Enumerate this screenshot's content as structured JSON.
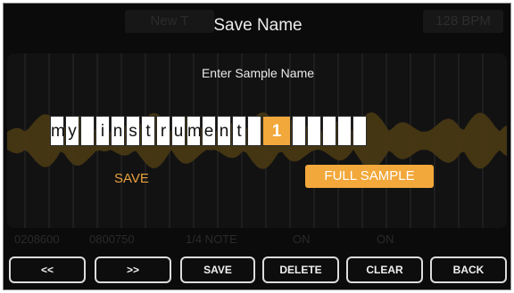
{
  "background_status": {
    "left_label": "New T",
    "tempo": "128 BPM"
  },
  "dialog": {
    "title": "Save Name",
    "prompt": "Enter Sample Name"
  },
  "name_field": {
    "characters": [
      "m",
      "y",
      " ",
      "i",
      "n",
      "s",
      "t",
      "r",
      "u",
      "m",
      "e",
      "n",
      "t",
      " ",
      "1",
      " ",
      " ",
      " ",
      " ",
      " "
    ],
    "cursor_index": 14
  },
  "options": {
    "save_label": "SAVE",
    "mode_label": "FULL SAMPLE"
  },
  "background_params": {
    "start": "0208600",
    "end": "0800750",
    "division": "1/4 NOTE",
    "param_a": "ON",
    "param_b": "ON"
  },
  "soft_buttons": [
    "<<",
    ">>",
    "SAVE",
    "DELETE",
    "CLEAR",
    "BACK"
  ],
  "colors": {
    "accent": "#f2a83a",
    "screen_bg": "#0b0b0b",
    "panel_bg": "#121212",
    "waveform": "#4a3a14"
  }
}
